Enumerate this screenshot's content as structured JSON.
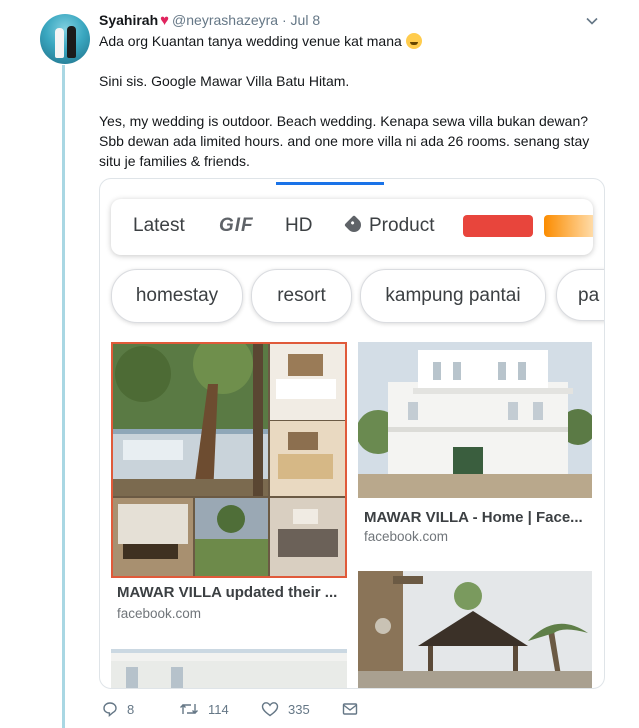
{
  "tweet": {
    "name": "Syahirah",
    "handle": "@neyrashazeyra",
    "date": "· Jul 8",
    "line1": "Ada org Kuantan tanya wedding venue kat mana",
    "para2": "Sini sis. Google Mawar Villa Batu Hitam.",
    "para3": "Yes, my wedding is outdoor. Beach wedding. Kenapa sewa villa bukan dewan? Sbb dewan ada limited hours. and one more villa ni ada 26 rooms. senang stay situ je families & friends."
  },
  "search_card": {
    "filters": {
      "latest": "Latest",
      "gif": "GIF",
      "hd": "HD",
      "product": "Product"
    },
    "swatch_colors": [
      "#e8453c",
      "#fb8c00"
    ],
    "chips": [
      "homestay",
      "resort",
      "kampung pantai",
      "pa"
    ],
    "results": [
      {
        "title": "MAWAR VILLA updated their ...",
        "source": "facebook.com"
      },
      {
        "title": "MAWAR VILLA - Home | Face...",
        "source": "facebook.com"
      }
    ]
  },
  "actions": {
    "replies": "8",
    "retweets": "114",
    "likes": "335"
  },
  "icons": [
    "heart-icon",
    "chevron-down-icon",
    "tag-icon",
    "reply-icon",
    "retweet-icon",
    "like-icon",
    "message-icon",
    "grinning-sweat-emoji"
  ]
}
